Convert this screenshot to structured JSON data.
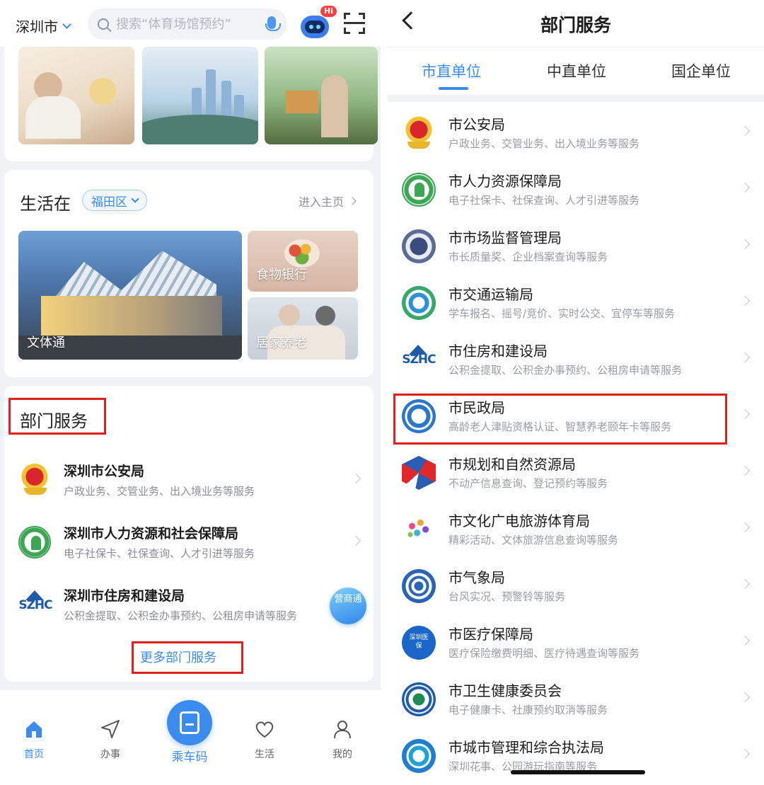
{
  "left": {
    "topbar": {
      "city": "深圳市",
      "search_placeholder": "搜索“体育场馆预约”",
      "robot_badge": "Hi"
    },
    "life": {
      "title": "生活在",
      "district": "福田区",
      "enter_home": "进入主页",
      "tiles": [
        "文体通",
        "食物银行",
        "居家养老"
      ]
    },
    "departments": {
      "title": "部门服务",
      "items": [
        {
          "name": "深圳市公安局",
          "desc": "户政业务、交管业务、出入境业务等服务",
          "icon": "police-badge-icon"
        },
        {
          "name": "深圳市人力资源和社会保障局",
          "desc": "电子社保卡、社保查询、人才引进等服务",
          "icon": "hr-bureau-icon"
        },
        {
          "name": "深圳市住房和建设局",
          "desc": "公积金提取、公积金办事预约、公租房申请等服务",
          "icon": "szhc-logo-icon"
        }
      ],
      "more": "更多部门服务",
      "float_badge": "营商通"
    },
    "tabbar": {
      "home": "首页",
      "affairs": "办事",
      "ride": "乘车码",
      "life": "生活",
      "mine": "我的"
    }
  },
  "right": {
    "title": "部门服务",
    "tabs": [
      "市直单位",
      "中直单位",
      "国企单位"
    ],
    "active_tab": "市直单位",
    "items": [
      {
        "name": "市公安局",
        "desc": "户政业务、交管业务、出入境业务等服务",
        "icon": "police-badge-icon"
      },
      {
        "name": "市人力资源保障局",
        "desc": "电子社保卡、社保查询、人才引进等服务",
        "icon": "hr-bureau-icon"
      },
      {
        "name": "市市场监督管理局",
        "desc": "市长质量奖、企业档案查询等服务",
        "icon": "market-supervision-icon"
      },
      {
        "name": "市交通运输局",
        "desc": "学车报名、摇号/竞价、实时公交、宜停车等服务",
        "icon": "transport-icon"
      },
      {
        "name": "市住房和建设局",
        "desc": "公积金提取、公积金办事预约、公租房申请等服务",
        "icon": "szhc-logo-icon"
      },
      {
        "name": "市民政局",
        "desc": "高龄老人津贴资格认证、智慧养老颐年卡等服务",
        "icon": "civil-affairs-icon"
      },
      {
        "name": "市规划和自然资源局",
        "desc": "不动产信息查询、登记预约等服务",
        "icon": "planning-icon"
      },
      {
        "name": "市文化广电旅游体育局",
        "desc": "精彩活动、文体旅游信息查询等服务",
        "icon": "culture-icon"
      },
      {
        "name": "市气象局",
        "desc": "台风实况、预警铃等服务",
        "icon": "weather-icon"
      },
      {
        "name": "市医疗保障局",
        "desc": "医疗保险缴费明细、医疗待遇查询等服务",
        "icon": "medical-insurance-icon"
      },
      {
        "name": "市卫生健康委员会",
        "desc": "电子健康卡、社康预约取消等服务",
        "icon": "health-commission-icon"
      },
      {
        "name": "市城市管理和综合执法局",
        "desc": "深圳花事、公园游玩指南等服务",
        "icon": "city-management-icon"
      }
    ]
  },
  "colors": {
    "accent": "#3c8cf0",
    "highlight_box": "#e02020",
    "page_bg": "#f1f2f5"
  }
}
